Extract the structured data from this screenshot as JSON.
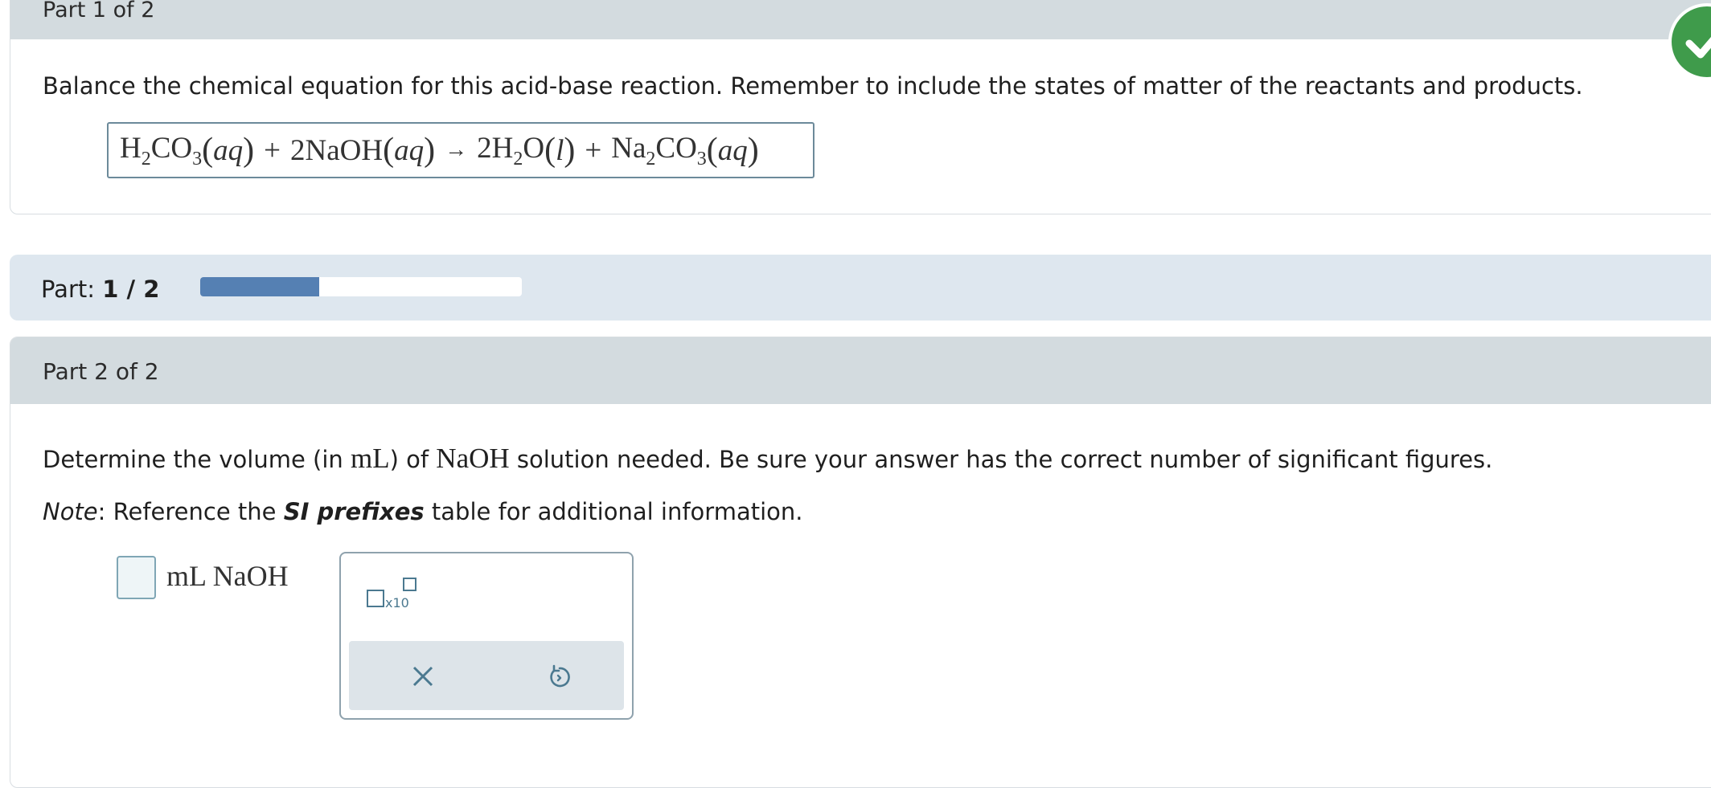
{
  "part1": {
    "title": "Part 1 of 2",
    "instruction": "Balance the chemical equation for this acid-base reaction. Remember to include the states of matter of the reactants and products.",
    "equation": {
      "r1_a": "H",
      "r1_sub1": "2",
      "r1_b": "CO",
      "r1_sub2": "3",
      "r1_state": "aq",
      "plus1": "+",
      "r2": "2NaOH",
      "r2_state": "aq",
      "arrow": "→",
      "p1_a": "2H",
      "p1_sub": "2",
      "p1_b": "O",
      "p1_state": "l",
      "plus2": "+",
      "p2_a": "Na",
      "p2_sub1": "2",
      "p2_b": "CO",
      "p2_sub2": "3",
      "p2_state": "aq"
    },
    "status_icon": "check-icon",
    "status_color": "#3f9b4b"
  },
  "progress": {
    "label": "Part:",
    "value_text": "1 / 2",
    "fraction": 0.37,
    "fill_color": "#5580b3"
  },
  "part2": {
    "title": "Part 2 of 2",
    "instr_pre": "Determine the volume (in ",
    "instr_unit": "mL",
    "instr_mid": ") of ",
    "instr_chem": "NaOH",
    "instr_post": " solution needed. Be sure your answer has the correct number of significant figures.",
    "note_label": "Note",
    "note_pre": ": Reference the ",
    "note_link": "SI prefixes",
    "note_post": " table for additional information.",
    "answer_value": "",
    "unit_label": "mL NaOH",
    "palette": {
      "sci_label": "x10",
      "clear_icon": "close-icon",
      "undo_icon": "undo-icon"
    }
  }
}
